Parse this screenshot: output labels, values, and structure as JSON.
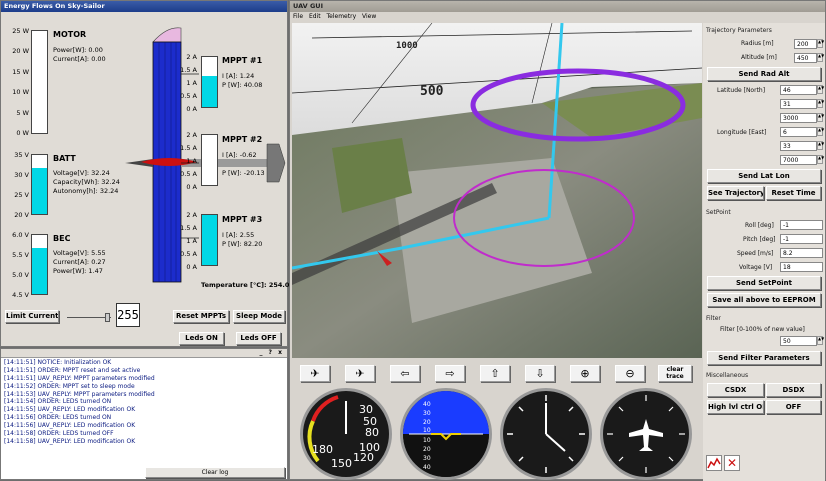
{
  "energy": {
    "title": "Energy Flows On Sky-Sailor",
    "motor": {
      "title": "MOTOR",
      "lines": [
        "Power[W]: 0.00",
        "Current[A]: 0.00"
      ],
      "ticks": [
        "25 W",
        "20 W",
        "15 W",
        "10 W",
        "5 W",
        "0 W"
      ],
      "level": 0.0
    },
    "batt": {
      "title": "BATT",
      "lines": [
        "Voltage[V]: 32.24",
        "Capacity[Wh]: 32.24",
        "Autonomy[h]: 32.24"
      ],
      "ticks": [
        "35 V",
        "30 V",
        "25 V",
        "20 V"
      ],
      "level": 0.78
    },
    "bec": {
      "title": "BEC",
      "lines": [
        "Voltage[V]: 5.55",
        "Current[A]: 0.27",
        "Power[W]: 1.47"
      ],
      "ticks": [
        "6.0 V",
        "5.5 V",
        "5.0 V",
        "4.5 V"
      ],
      "level": 0.78
    },
    "mppt1": {
      "title": "MPPT #1",
      "lines": [
        "I [A]: 1.24",
        "P [W]: 40.08"
      ],
      "ticks": [
        "2 A",
        "1.5 A",
        "1 A",
        "0.5 A",
        "0 A"
      ],
      "level": 0.62
    },
    "mppt2": {
      "title": "MPPT #2",
      "lines": [
        "I [A]: -0.62",
        "P [W]: -20.13"
      ],
      "ticks": [
        "2 A",
        "1.5 A",
        "1 A",
        "0.5 A",
        "0 A"
      ],
      "level": 0.0
    },
    "mppt3": {
      "title": "MPPT #3",
      "lines": [
        "I [A]: 2.55",
        "P [W]: 82.20"
      ],
      "ticks": [
        "2 A",
        "1.5 A",
        "1 A",
        "0.5 A",
        "0 A"
      ],
      "level": 1.0
    },
    "temperature": "Temperature [°C]: 254.00",
    "limit_current": "Limit Current",
    "slider_value": "255",
    "reset_mppts": "Reset MPPTs",
    "sleep_mode": "Sleep Mode",
    "leds_on": "Leds ON",
    "leds_off": "Leds OFF"
  },
  "log": {
    "lines": [
      "[14:11:51] NOTICE: Initialization OK",
      "[14:11:51] ORDER: MPPT reset and set active",
      "[14:11:51] UAV_REPLY: MPPT parameters modified",
      "[14:11:52] ORDER: MPPT set to sleep mode",
      "[14:11:53] UAV_REPLY: MPPT parameters modified",
      "[14:11:54] ORDER: LEDS turned ON",
      "[14:11:55] UAV_REPLY: LED modification OK",
      "[14:11:56] ORDER: LEDS turned ON",
      "[14:11:56] UAV_REPLY: LED modification OK",
      "[14:11:58] ORDER: LEDS turned OFF",
      "[14:11:58] UAV_REPLY: LED modification OK"
    ],
    "clear_log": "Clear log",
    "controls": "_ ? x"
  },
  "gui": {
    "title": "UAV GUI",
    "menu": [
      "File",
      "Edit",
      "Telemetry",
      "View"
    ],
    "grid_labels": [
      "1000",
      "500"
    ],
    "toolbar_clear": "clear trace",
    "gauge_speed": [
      "180",
      "150",
      "120",
      "100",
      "80",
      "50",
      "30"
    ],
    "gauge_ah": [
      "40",
      "30",
      "20",
      "10",
      "10",
      "20",
      "30",
      "40"
    ]
  },
  "params": {
    "trajectory": {
      "title": "Trajectory Parameters",
      "radius_label": "Radius [m]",
      "radius": "200",
      "altitude_label": "Altitude [m]",
      "altitude": "450",
      "send_rad_alt": "Send Rad  Alt",
      "lat_label": "Latitude [North]",
      "lat": [
        "46",
        "31",
        "3000"
      ],
      "lon_label": "Longitude [East]",
      "lon": [
        "6",
        "33",
        "7000"
      ],
      "send_lat_lon": "Send Lat  Lon",
      "see_trajectory": "See Trajectory",
      "reset_time": "Reset Time"
    },
    "setpoint": {
      "title": "SetPoint",
      "roll_label": "Roll [deg]",
      "roll": "-1",
      "pitch_label": "Pitch [deg]",
      "pitch": "-1",
      "speed_label": "Speed [m/s]",
      "speed": "8.2",
      "voltage_label": "Voltage [V]",
      "voltage": "18",
      "send_setpoint": "Send SetPoint",
      "save_eeprom": "Save all above to EEPROM"
    },
    "filter": {
      "title": "Filter",
      "filter_label": "Filter [0-100% of new value]",
      "filter_value": "50",
      "send_filter": "Send Filter Parameters"
    },
    "misc": {
      "title": "Miscellaneous",
      "csdx": "CSDX",
      "dsdx": "DSDX",
      "high_lvl": "High lvl ctrl ON",
      "off": "OFF"
    }
  },
  "colors": {
    "accent": "#00d8e6",
    "fuselage": "#1c2ccc",
    "wing": "#cc1010",
    "ring": "#8a2ce0",
    "route": "#33c8ee"
  }
}
